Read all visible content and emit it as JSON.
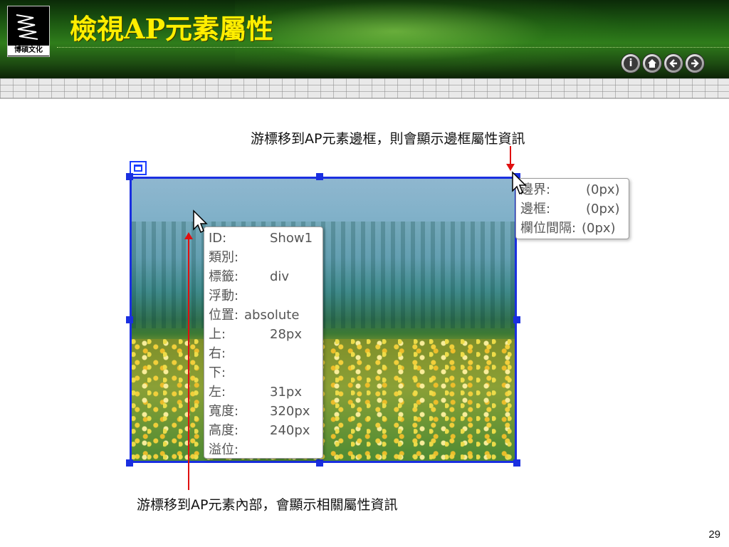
{
  "header": {
    "logo_text": "博碩文化",
    "title": "檢視AP元素屬性",
    "nav_icons": [
      "info-icon",
      "home-icon",
      "back-arrow-icon",
      "forward-arrow-icon"
    ]
  },
  "captions": {
    "top": "游標移到AP元素邊框，則會顯示邊框屬性資訊",
    "bottom": "游標移到AP元素內部，會顯示相關屬性資訊"
  },
  "element_tooltip": {
    "rows": [
      {
        "label": "ID:",
        "value": "Show1"
      },
      {
        "label": "類別:",
        "value": ""
      },
      {
        "label": "標籤:",
        "value": "div"
      },
      {
        "label": "浮動:",
        "value": ""
      },
      {
        "label": "位置:",
        "value": "absolute"
      },
      {
        "label": "上:",
        "value": "28px"
      },
      {
        "label": "右:",
        "value": ""
      },
      {
        "label": "下:",
        "value": ""
      },
      {
        "label": "左:",
        "value": "31px"
      },
      {
        "label": "寬度:",
        "value": "320px"
      },
      {
        "label": "高度:",
        "value": "240px"
      },
      {
        "label": "溢位:",
        "value": ""
      }
    ]
  },
  "border_tooltip": {
    "rows": [
      {
        "label": "邊界:",
        "value": "(0px)"
      },
      {
        "label": "邊框:",
        "value": "(0px)"
      },
      {
        "label": "欄位間隔:",
        "value": "(0px)"
      }
    ]
  },
  "colors": {
    "selection_blue": "#1a2fe0",
    "annotation_red": "#e01010",
    "title_yellow": "#ffee00",
    "header_green": "#2f7d1b"
  },
  "page_number": "29"
}
